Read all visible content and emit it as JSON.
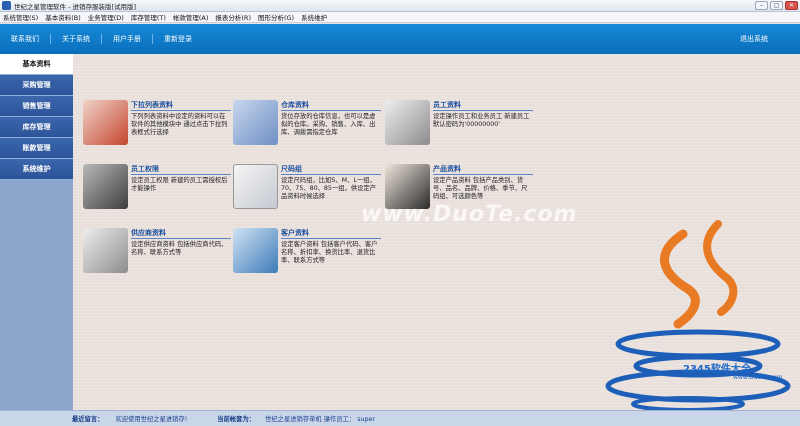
{
  "window": {
    "title": "世纪之星管理软件 - 进销存服装版[试用版]"
  },
  "menubar": {
    "items": [
      "系统管理(S)",
      "基本资料(B)",
      "业务管理(D)",
      "库存管理(T)",
      "帐款管理(A)",
      "报表分析(R)",
      "图形分析(G)",
      "系统维护"
    ]
  },
  "toolbar": {
    "items": [
      "联系我们",
      "关于系统",
      "用户手册",
      "重新登录"
    ],
    "exit_label": "退出系统"
  },
  "sidebar": {
    "items": [
      "基本资料",
      "采购管理",
      "销售管理",
      "库存管理",
      "账款管理",
      "系统维护"
    ],
    "active_index": 0
  },
  "modules": [
    {
      "title": "下拉列表资料",
      "desc": "下列列表资料中设定的资料可以在软件的其他模块中 通过点击下拉列表框式行选择",
      "icon": "dropdown-list-icon"
    },
    {
      "title": "仓库资料",
      "desc": "货位存放的仓库信息，也可以是虚拟的仓库。采购、销售、入库、出库、调拨需指定仓库",
      "icon": "warehouse-icon"
    },
    {
      "title": "员工资料",
      "desc": "设定操作员工和业务员工 新建员工默认密码为'00000000'",
      "icon": "staff-icon"
    },
    {
      "title": "员工权限",
      "desc": "设定员工权限 新建的员工需授权后才能操作",
      "icon": "permission-icon"
    },
    {
      "title": "尺码组",
      "desc": "设定尺码组，比如S、M、L一组，70、75、80、85一组，供设定产品资料时候选择",
      "icon": "size-group-icon"
    },
    {
      "title": "产品资料",
      "desc": "设定产品资料 包括产品类别、货号、品名、品牌、价格、季节、尺码组、可选颜色等",
      "icon": "product-icon"
    },
    {
      "title": "供应商资料",
      "desc": "设定供应商资料 包括供应商代码、名称、联系方式等",
      "icon": "supplier-icon"
    },
    {
      "title": "客户资料",
      "desc": "设定客户资料 包括客户代码、客户名称、折扣率、换货比率、退货比率、联系方式等",
      "icon": "customer-icon"
    }
  ],
  "watermarks": {
    "center": "www.DuoTe.com",
    "corner_brand": "2345软件大全",
    "corner_url": "www.DuoTe.com"
  },
  "statusbar": {
    "message_label": "最近留言：",
    "message_value": "欢迎使用世纪之星进销存!",
    "account_label": "当前帐套为：",
    "account_value": "世纪之星进销存单机 操作员工： super"
  },
  "colors": {
    "toolbar_blue": "#0f7cc9",
    "sidebar_blue": "#2c5498",
    "java_orange": "#e87a24",
    "java_blue": "#1d5fb8"
  }
}
